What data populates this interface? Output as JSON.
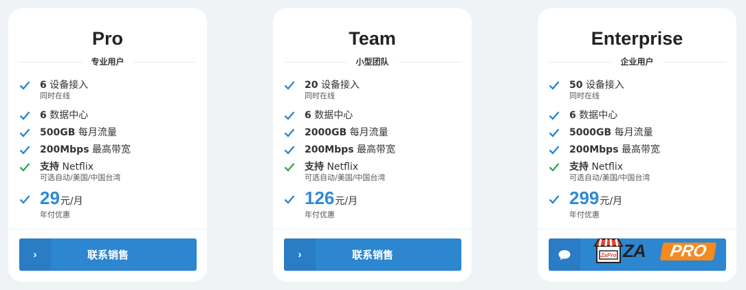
{
  "colors": {
    "accent": "#2d8ad6",
    "button": "#2d86d0",
    "check_blue": "#2d86d0",
    "check_green": "#33a853",
    "logo_orange": "#f58a1f"
  },
  "plans": [
    {
      "title": "Pro",
      "subtitle": "专业用户",
      "devices": {
        "num": "6",
        "label": "设备接入",
        "note": "同时在线"
      },
      "datacenters": {
        "num": "6",
        "label": "数据中心"
      },
      "traffic": {
        "num": "500GB",
        "label": "每月流量"
      },
      "bandwidth": {
        "num": "200Mbps",
        "label": "最高带宽"
      },
      "netflix": {
        "bold": "支持",
        "label": "Netflix",
        "note": "可选自动/美国/中国台湾"
      },
      "price": {
        "amount": "29",
        "unit": "元/月",
        "note": "年付优惠"
      },
      "cta": {
        "icon": "chevron-right-icon",
        "label": "联系销售"
      }
    },
    {
      "title": "Team",
      "subtitle": "小型团队",
      "devices": {
        "num": "20",
        "label": "设备接入",
        "note": "同时在线"
      },
      "datacenters": {
        "num": "6",
        "label": "数据中心"
      },
      "traffic": {
        "num": "2000GB",
        "label": "每月流量"
      },
      "bandwidth": {
        "num": "200Mbps",
        "label": "最高带宽"
      },
      "netflix": {
        "bold": "支持",
        "label": "Netflix",
        "note": "可选自动/美国/中国台湾"
      },
      "price": {
        "amount": "126",
        "unit": "元/月",
        "note": "年付优惠"
      },
      "cta": {
        "icon": "chevron-right-icon",
        "label": "联系销售"
      }
    },
    {
      "title": "Enterprise",
      "subtitle": "企业用户",
      "devices": {
        "num": "50",
        "label": "设备接入",
        "note": "同时在线"
      },
      "datacenters": {
        "num": "6",
        "label": "数据中心"
      },
      "traffic": {
        "num": "5000GB",
        "label": "每月流量"
      },
      "bandwidth": {
        "num": "200Mbps",
        "label": "最高带宽"
      },
      "netflix": {
        "bold": "支持",
        "label": "Netflix",
        "note": "可选自动/美国/中国台湾"
      },
      "price": {
        "amount": "299",
        "unit": "元/月",
        "note": "年付优惠"
      },
      "cta": {
        "icon": "chat-bubble-icon",
        "label": ""
      }
    }
  ],
  "watermark": {
    "brand": "ZA",
    "badge": "PRO",
    "sign_text": "ZaPro"
  }
}
